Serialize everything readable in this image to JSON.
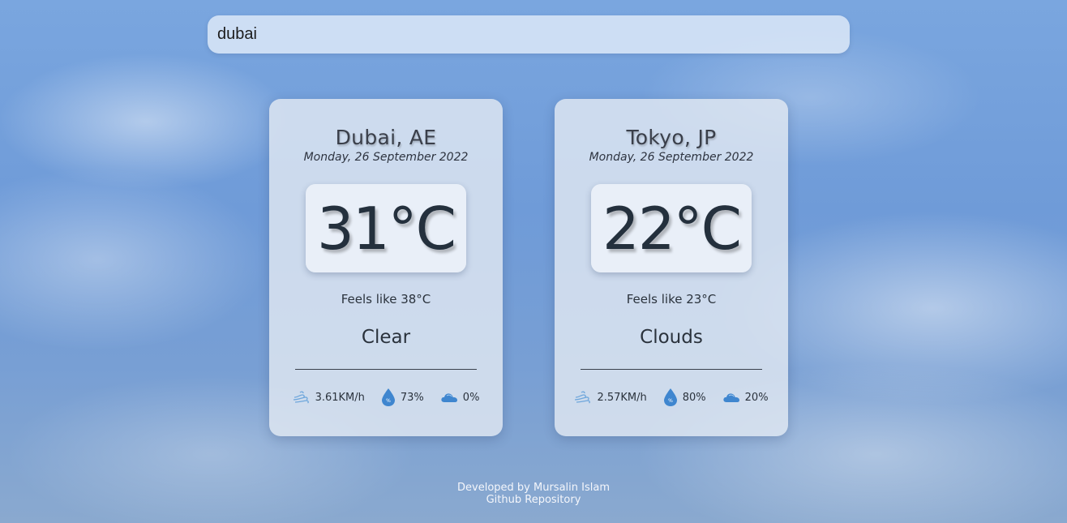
{
  "search": {
    "value": "dubai"
  },
  "cards": [
    {
      "city": "Dubai, AE",
      "date": "Monday, 26 September 2022",
      "temperature": "31°C",
      "feels_like": "Feels like 38°C",
      "condition": "Clear",
      "wind": "3.61KM/h",
      "humidity": "73%",
      "clouds": "0%"
    },
    {
      "city": "Tokyo, JP",
      "date": "Monday, 26 September 2022",
      "temperature": "22°C",
      "feels_like": "Feels like 23°C",
      "condition": "Clouds",
      "wind": "2.57KM/h",
      "humidity": "80%",
      "clouds": "20%"
    }
  ],
  "icons": {
    "wind": "wind-icon",
    "humidity": "humidity-drop-icon",
    "clouds": "cloud-icon",
    "accent": "#3f86cf"
  },
  "footer": {
    "developer": "Developed by Mursalin Islam",
    "repo_link": "Github Repository"
  }
}
